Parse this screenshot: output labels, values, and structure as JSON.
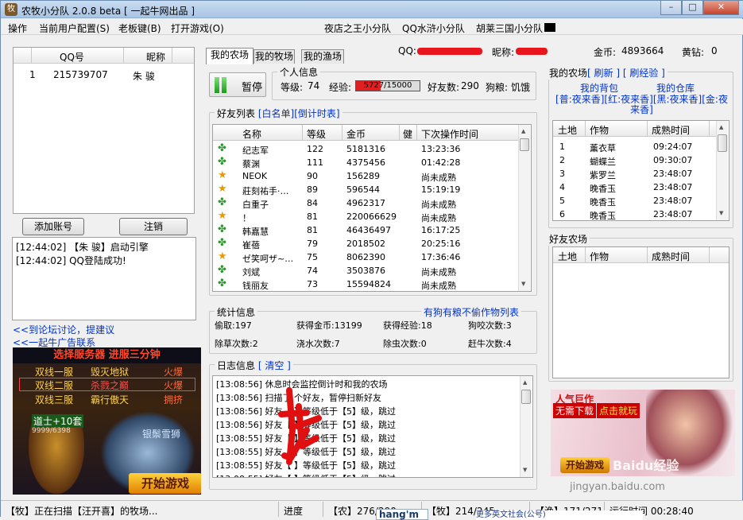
{
  "window": {
    "title": "农牧小分队 2.0.8 beta [ 一起牛网出品 ]",
    "blurred_tail": "",
    "controls": {
      "minimize": "–",
      "maximize": "□",
      "close": "✕"
    }
  },
  "menu": [
    "操作",
    "当前用户配置(S)",
    "老板键(B)",
    "打开游戏(O)"
  ],
  "menu_right": [
    "夜店之王小分队",
    "QQ水浒小分队",
    "胡莱三国小分队"
  ],
  "accounts": {
    "headers": [
      "",
      "QQ号",
      "昵称"
    ],
    "rows": [
      {
        "idx": "1",
        "qq": "215739707",
        "name": "朱 骏"
      }
    ]
  },
  "account_buttons": {
    "add": "添加账号",
    "remove": "注销"
  },
  "console": [
    "[12:44:02] 【朱 骏】启动引擎",
    "[12:44:02] QQ登陆成功!"
  ],
  "links": {
    "forum": "<<到论坛讨论，提建议",
    "ads": "<<一起牛广告联系"
  },
  "ad_left": {
    "headline": "选择服务器 进服三分钟",
    "rows": [
      [
        "双线一服",
        "毁灭地狱",
        "火爆"
      ],
      [
        "双线二服",
        "杀戮之巅",
        "火爆"
      ],
      [
        "双线三服",
        "霸行傲天",
        "拥挤"
      ]
    ],
    "hero": "道士+10套",
    "hero_sub": "9999/6398",
    "hero_right": "银鬃雪狮",
    "cta": "开始游戏"
  },
  "tabs": [
    "我的农场",
    "我的牧场",
    "我的渔场"
  ],
  "account_info": {
    "qq_label": "QQ:",
    "qq_value": "",
    "nick_label": "昵称:",
    "nick_value": "",
    "gold_label": "金币:",
    "gold_value": "4893664",
    "diamond_label": "黄钻:",
    "diamond_value": "0"
  },
  "personal": {
    "title": "个人信息",
    "pause": "暂停",
    "level_label": "等级:",
    "level": "74",
    "exp_label": "经验:",
    "exp": "5727/15000",
    "exp_fraction": 0.382,
    "friends_label": "好友数:",
    "friends": "290",
    "dog_label": "狗粮:",
    "dog": "饥饿"
  },
  "friends_list": {
    "title": "好友列表",
    "whitelist": "[白名单]",
    "countdown": "[倒计时表]",
    "headers": [
      "名称",
      "等级",
      "金币",
      "健",
      "下次操作时间"
    ],
    "rows": [
      {
        "icon": "clover",
        "name": "纪志军",
        "level": "122",
        "gold": "5181316",
        "time": "13:23:36"
      },
      {
        "icon": "clover",
        "name": "蔡渊",
        "level": "111",
        "gold": "4375456",
        "time": "01:42:28"
      },
      {
        "icon": "star",
        "name": "NEOK",
        "level": "90",
        "gold": "156289",
        "time": "尚未成熟"
      },
      {
        "icon": "star",
        "name": "莊刻祐手·…",
        "level": "89",
        "gold": "596544",
        "time": "15:19:19"
      },
      {
        "icon": "clover",
        "name": "白重子",
        "level": "84",
        "gold": "4962317",
        "time": "尚未成熟"
      },
      {
        "icon": "star",
        "name": "！",
        "level": "81",
        "gold": "220066629",
        "time": "尚未成熟"
      },
      {
        "icon": "clover",
        "name": "韩嘉慧",
        "level": "81",
        "gold": "46436497",
        "time": "16:17:25"
      },
      {
        "icon": "clover",
        "name": "崔蓓",
        "level": "79",
        "gold": "2018502",
        "time": "20:25:16"
      },
      {
        "icon": "star",
        "name": "ゼ笑呵ザ~…",
        "level": "75",
        "gold": "8062390",
        "time": "17:36:46"
      },
      {
        "icon": "clover",
        "name": "刘斌",
        "level": "74",
        "gold": "3503876",
        "time": "尚未成熟"
      },
      {
        "icon": "clover",
        "name": "钱丽友",
        "level": "73",
        "gold": "15594824",
        "time": "尚未成熟"
      }
    ]
  },
  "stats": {
    "title": "统计信息",
    "link": "有狗有粮不偷作物列表",
    "items": [
      [
        "偷取:",
        "197"
      ],
      [
        "获得金币:",
        "13199"
      ],
      [
        "获得经验:",
        "18"
      ],
      [
        "狗咬次数:",
        "3"
      ],
      [
        "除草次数:",
        "2"
      ],
      [
        "浇水次数:",
        "7"
      ],
      [
        "除虫次数:",
        "0"
      ],
      [
        "赶牛次数:",
        "4"
      ]
    ]
  },
  "log": {
    "title": "日志信息",
    "clear": "[ 清空 ]",
    "lines": [
      "[13:08:56] 休息时会监控倒计时和我的农场",
      "[13:08:56] 扫描了    个好友，暂停扫新好友",
      "[13:08:56] 好友【    】等级低于【5】级，跳过",
      "[13:08:56] 好友【    】等级低于【5】级，跳过",
      "[13:08:55] 好友【    】等级低于【5】级，跳过",
      "[13:08:55] 好友【    】等级低于【5】级，跳过",
      "[13:08:55] 好友【    】等级低于【5】级，跳过",
      "[13:08:55] 好友【    】等级低于【5】级，跳过"
    ]
  },
  "my_farm": {
    "title": "我的农场",
    "refresh": "[ 刷新 ]",
    "exp": "[ 刷经验 ]",
    "bag": "我的背包",
    "warehouse": "我的仓库",
    "night_links": "[普:夜来香][红:夜来香][黑:夜来香][金:夜来香]",
    "headers": [
      "土地",
      "作物",
      "成熟时间"
    ],
    "rows": [
      [
        "1",
        "薰衣草",
        "09:24:07"
      ],
      [
        "2",
        "蝴蝶兰",
        "09:30:07"
      ],
      [
        "3",
        "紫罗兰",
        "23:48:07"
      ],
      [
        "4",
        "晚香玉",
        "23:48:07"
      ],
      [
        "5",
        "晚香玉",
        "23:48:07"
      ],
      [
        "6",
        "晚香玉",
        "23:48:07"
      ]
    ]
  },
  "friend_farm": {
    "title": "好友农场",
    "headers": [
      "土地",
      "作物",
      "成熟时间"
    ]
  },
  "ad_right": {
    "top": "人气巨作",
    "download": "无需下载",
    "click": "点击就玩",
    "bottom": "开始游戏",
    "watermark": "Baidu经验",
    "url": "jingyan.baidu.com"
  },
  "status": {
    "scan": "【牧】正在扫描【汪开喜】的牧场...",
    "progress_label": "进度",
    "farm": "【农】276/290",
    "pasture": "【牧】214/245",
    "fish": "【渔】171/271",
    "runtime": "运行时间 00:28:40",
    "popup": "hang'm",
    "popup2": "更多英文社会(公号)"
  }
}
